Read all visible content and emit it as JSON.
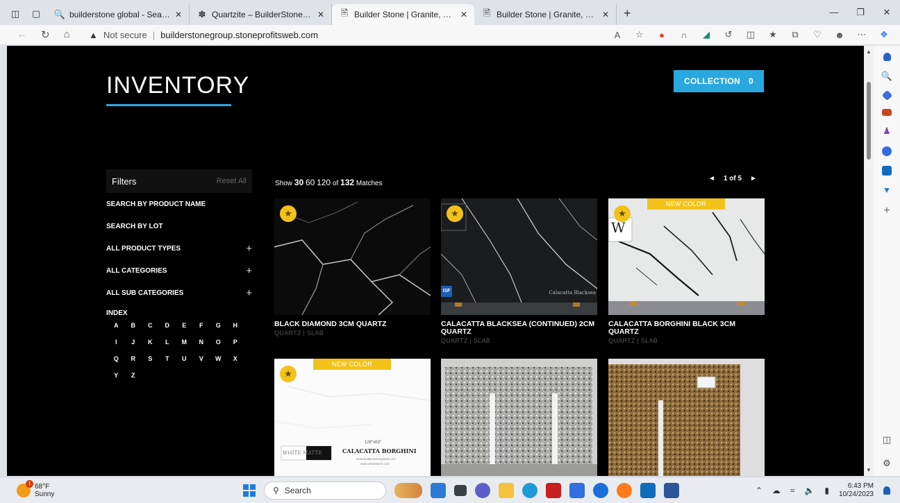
{
  "browser": {
    "tabs": [
      {
        "title": "builderstone global - Search",
        "icon": "search-icon",
        "active": false
      },
      {
        "title": "Quartzite – BuilderStone Global | ",
        "icon": "site-icon",
        "active": false
      },
      {
        "title": "Builder Stone | Granite, Marble, C",
        "icon": "page-icon",
        "active": true
      },
      {
        "title": "Builder Stone | Granite, Marble, C",
        "icon": "page-icon",
        "active": false
      }
    ],
    "new_tab": "+",
    "security": "Not secure",
    "url": "builderstonegroup.stoneprofitsweb.com",
    "extension_icons": [
      "read-aloud-icon",
      "favorite-icon",
      "opera-icon",
      "cloud-icon",
      "app-icon",
      "refresh-icon",
      "split-icon",
      "favorites-icon",
      "collections-icon",
      "performance-icon",
      "profile-icon",
      "more-icon"
    ]
  },
  "site": {
    "title": "INVENTORY",
    "collection_label": "COLLECTION",
    "collection_count": "0",
    "filters": {
      "heading": "Filters",
      "reset": "Reset All",
      "rows": [
        {
          "label": "SEARCH BY PRODUCT NAME",
          "expand": ""
        },
        {
          "label": "SEARCH BY LOT",
          "expand": ""
        },
        {
          "label": "ALL PRODUCT TYPES",
          "expand": "+"
        },
        {
          "label": "ALL CATEGORIES",
          "expand": "+"
        },
        {
          "label": "ALL SUB CATEGORIES",
          "expand": "+"
        }
      ],
      "index_label": "INDEX",
      "index_letters": [
        "A",
        "B",
        "C",
        "D",
        "E",
        "F",
        "G",
        "H",
        "I",
        "J",
        "K",
        "L",
        "M",
        "N",
        "O",
        "P",
        "Q",
        "R",
        "S",
        "T",
        "U",
        "V",
        "W",
        "X",
        "Y",
        "Z"
      ]
    },
    "results": {
      "show_label": "Show",
      "opt_30": "30",
      "opt_60": "60",
      "opt_120": "120",
      "of_label": "of",
      "total": "132",
      "matches_label": "Matches",
      "page": "1 of 5",
      "prev": "◄",
      "next": "►"
    },
    "products": [
      {
        "name": "BLACK DIAMOND 3CM QUARTZ",
        "meta": "QUARTZ | SLAB",
        "badge": ""
      },
      {
        "name": "CALACATTA BLACKSEA (CONTINUED) 2CM QUARTZ",
        "meta": "QUARTZ | SLAB",
        "badge": ""
      },
      {
        "name": "CALACATTA BORGHINI BLACK 3CM QUARTZ",
        "meta": "QUARTZ | SLAB",
        "badge": "NEW COLOR"
      },
      {
        "name": "",
        "meta": "",
        "badge": "NEW COLOR"
      },
      {
        "name": "",
        "meta": "",
        "badge": ""
      },
      {
        "name": "",
        "meta": "",
        "badge": ""
      }
    ],
    "card_overlays": {
      "blacksea_mark": "Calacatta Blacksea",
      "blacksea_logo": "ISF",
      "borghini_black_logo": "W",
      "borghini_size": "126\"x63\"",
      "borghini_name": "CALACATTA BORGHINI",
      "borghini_brand": "WHITE MATTE",
      "borghini_web1": "www.builderstoneglobal.com",
      "borghini_web2": "www.whitestone.com"
    }
  },
  "taskbar": {
    "temp": "68°F",
    "condition": "Sunny",
    "weather_badge": "1",
    "search_placeholder": "Search",
    "time": "6:43 PM",
    "date": "10/24/2023"
  },
  "colors": {
    "accent": "#29a8df",
    "badge": "#f2c21b",
    "page_bg": "#000000"
  }
}
